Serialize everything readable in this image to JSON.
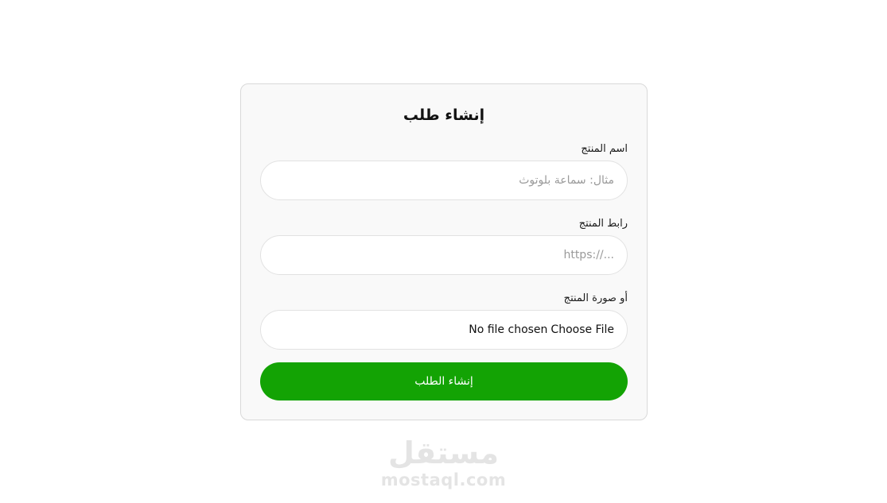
{
  "form": {
    "title": "إنشاء طلب",
    "product_name": {
      "label": "اسم المنتج",
      "placeholder": "مثال: سماعة بلوتوث",
      "value": ""
    },
    "product_link": {
      "label": "رابط المنتج",
      "placeholder": "https://...",
      "value": ""
    },
    "product_image": {
      "label": "أو صورة المنتج",
      "button_label": "Choose File",
      "status_text": "No file chosen"
    },
    "submit_label": "إنشاء الطلب"
  },
  "watermark": {
    "arabic": "مستقل",
    "latin": "mostaql.com"
  },
  "colors": {
    "primary": "#13a304",
    "card_bg": "#f9f9f9",
    "border": "#d9d9d9",
    "watermark": "#e4e4e4"
  }
}
